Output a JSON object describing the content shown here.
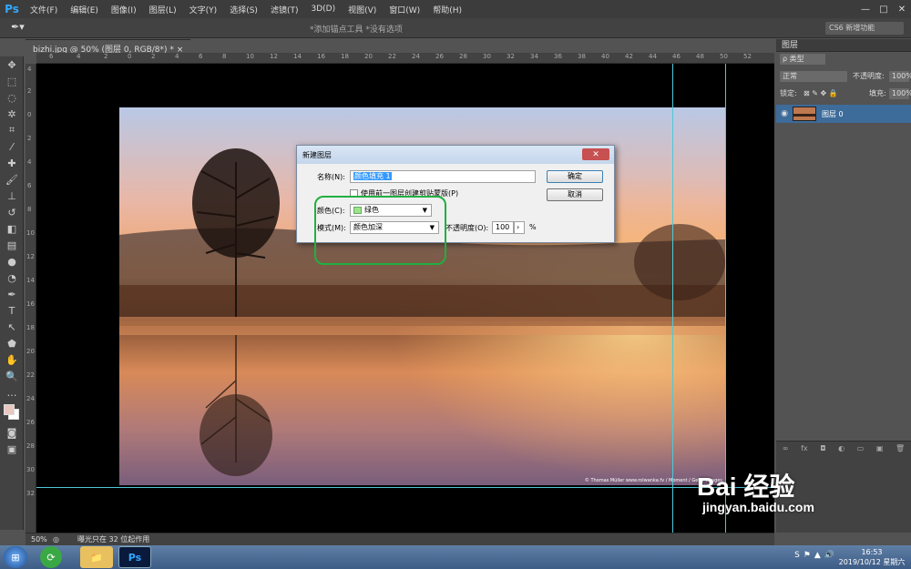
{
  "app": {
    "logo": "Ps",
    "menu": [
      "文件(F)",
      "编辑(E)",
      "图像(I)",
      "图层(L)",
      "文字(Y)",
      "选择(S)",
      "滤镜(T)",
      "3D(D)",
      "视图(V)",
      "窗口(W)",
      "帮助(H)"
    ],
    "window_controls": [
      "—",
      "□",
      "✕"
    ]
  },
  "options_bar": {
    "hint": "*添加锚点工具 *没有选项",
    "workspace": "CS6 新增功能"
  },
  "document": {
    "tab_title": "bizhi.jpg @ 50% (图层 0, RGB/8*) *",
    "tab_close": "×",
    "ruler_top": [
      "6",
      "4",
      "2",
      "0",
      "2",
      "4",
      "6",
      "8",
      "10",
      "12",
      "14",
      "16",
      "18",
      "20",
      "22",
      "24",
      "26",
      "28",
      "30",
      "32",
      "34",
      "36",
      "38",
      "40",
      "42",
      "44",
      "46",
      "48",
      "50",
      "52"
    ],
    "ruler_left": [
      "4",
      "2",
      "0",
      "2",
      "4",
      "6",
      "8",
      "10",
      "12",
      "14",
      "16",
      "18",
      "20",
      "22",
      "24",
      "26",
      "28",
      "30",
      "32"
    ],
    "photo_credit": "© Thomas Müller www.rolwanka.fv / Moment / Getty Images"
  },
  "dialog": {
    "title": "新建图层",
    "close": "✕",
    "name_label": "名称(N):",
    "name_value": "颜色填充 1",
    "clip_label": "使用前一图层创建剪贴蒙版(P)",
    "color_label": "颜色(C):",
    "color_value": "绿色",
    "color_swatch": "#9ee28a",
    "mode_label": "模式(M):",
    "mode_value": "颜色加深",
    "opacity_label": "不透明度(O):",
    "opacity_value": "100",
    "opacity_unit": "%",
    "ok": "确定",
    "cancel": "取消"
  },
  "layers_panel": {
    "title": "图层",
    "filter": "ρ 类型",
    "blend_mode": "正常",
    "opacity_label": "不透明度:",
    "opacity_value": "100%",
    "lock_label": "锁定:",
    "fill_label": "填充:",
    "fill_value": "100%",
    "layer_name": "图层 0",
    "footer_icons": [
      "∞",
      "fx",
      "◘",
      "◐",
      "▭",
      "▣",
      "🗑"
    ]
  },
  "status": {
    "zoom": "50%",
    "info": "曝光只在 32 位起作用"
  },
  "taskbar": {
    "time": "16:53",
    "date": "2019/10/12 星期六",
    "tray": [
      "S",
      "⚑",
      "▲",
      "🔊"
    ]
  },
  "watermark": {
    "logo": "Bai 经验",
    "url": "jingyan.baidu.com"
  },
  "colors": {
    "annotation": "#20b040",
    "layer_selected": "#3d6b9a",
    "guide": "#4fc8d8"
  }
}
